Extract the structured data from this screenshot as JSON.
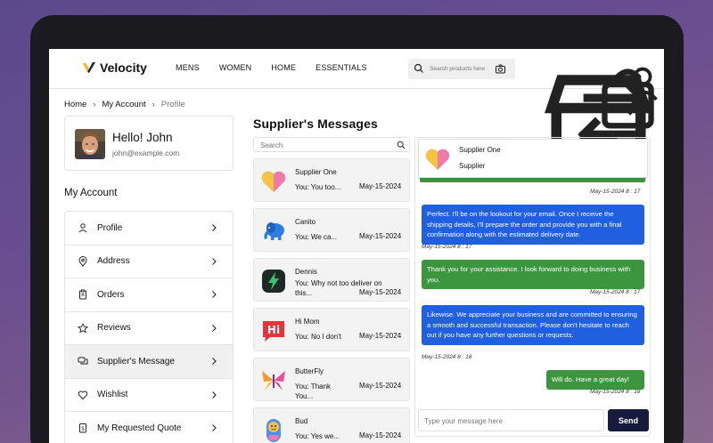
{
  "header": {
    "brand": "Velocity",
    "nav": [
      "MENS",
      "WOMEN",
      "HOME",
      "ESSENTIALS"
    ],
    "search_placeholder": "Search products here",
    "icons": [
      "store-icon",
      "compare-icon",
      "bag-icon",
      "user-icon"
    ]
  },
  "breadcrumb": {
    "home": "Home",
    "account": "My Account",
    "current": "Profile"
  },
  "profile": {
    "greeting": "Hello! John",
    "email": "john@example.com"
  },
  "account_menu": {
    "title": "My Account",
    "items": [
      {
        "label": "Profile",
        "icon": "user-icon"
      },
      {
        "label": "Address",
        "icon": "location-icon"
      },
      {
        "label": "Orders",
        "icon": "clipboard-icon"
      },
      {
        "label": "Reviews",
        "icon": "star-icon"
      },
      {
        "label": "Supplier's Message",
        "icon": "chat-icon",
        "active": true
      },
      {
        "label": "Wishlist",
        "icon": "heart-icon"
      },
      {
        "label": "My Requested Quote",
        "icon": "quote-icon"
      }
    ]
  },
  "messages": {
    "title": "Supplier's Messages",
    "search_placeholder": "Search",
    "conversations": [
      {
        "name": "Supplier One",
        "preview": "You: You too...",
        "date": "May-15-2024"
      },
      {
        "name": "Canito",
        "preview": "You: We ca...",
        "date": "May-15-2024"
      },
      {
        "name": "Dennis",
        "preview": "You: Why not too deliver on this...",
        "date": "May-15-2024"
      },
      {
        "name": "Hi Mom",
        "preview": "You: No I don't",
        "date": "May-15-2024"
      },
      {
        "name": "ButterFly",
        "preview": "You: Thank You...",
        "date": "May-15-2024"
      },
      {
        "name": "Bud",
        "preview": "You: Yes we...",
        "date": "May-15-2024"
      }
    ]
  },
  "chat": {
    "contact_name": "Supplier One",
    "contact_role": "Supplier",
    "top_timestamp": "May-15-2024 8 : 17",
    "messages": [
      {
        "from": "supplier",
        "text": "Perfect. I'll be on the lookout for your email. Once I receive the shipping details, I'll prepare the order and provide you with a final confirmation along with the estimated delivery date.",
        "time": "May-15-2024 8 : 17"
      },
      {
        "from": "you",
        "text": "Thank you for your assistance. I look forward to doing business with you.",
        "time": "May-15-2024 8 : 17"
      },
      {
        "from": "supplier",
        "text": "Likewise. We appreciate your business and are committed to ensuring a smooth and successful transaction. Please don't hesitate to reach out if you have any further questions or requests.",
        "time": "May-15-2024 8 : 18"
      },
      {
        "from": "you",
        "text": "Will do. Have a great day!",
        "time": "May-15-2024 8 : 18"
      }
    ],
    "input_placeholder": "Type your message here",
    "send_label": "Send"
  },
  "colors": {
    "blue_bubble": "#1f5fe0",
    "green_bubble": "#3c9640",
    "send_button": "#161b3d",
    "logo_yellow": "#f2b71f"
  }
}
